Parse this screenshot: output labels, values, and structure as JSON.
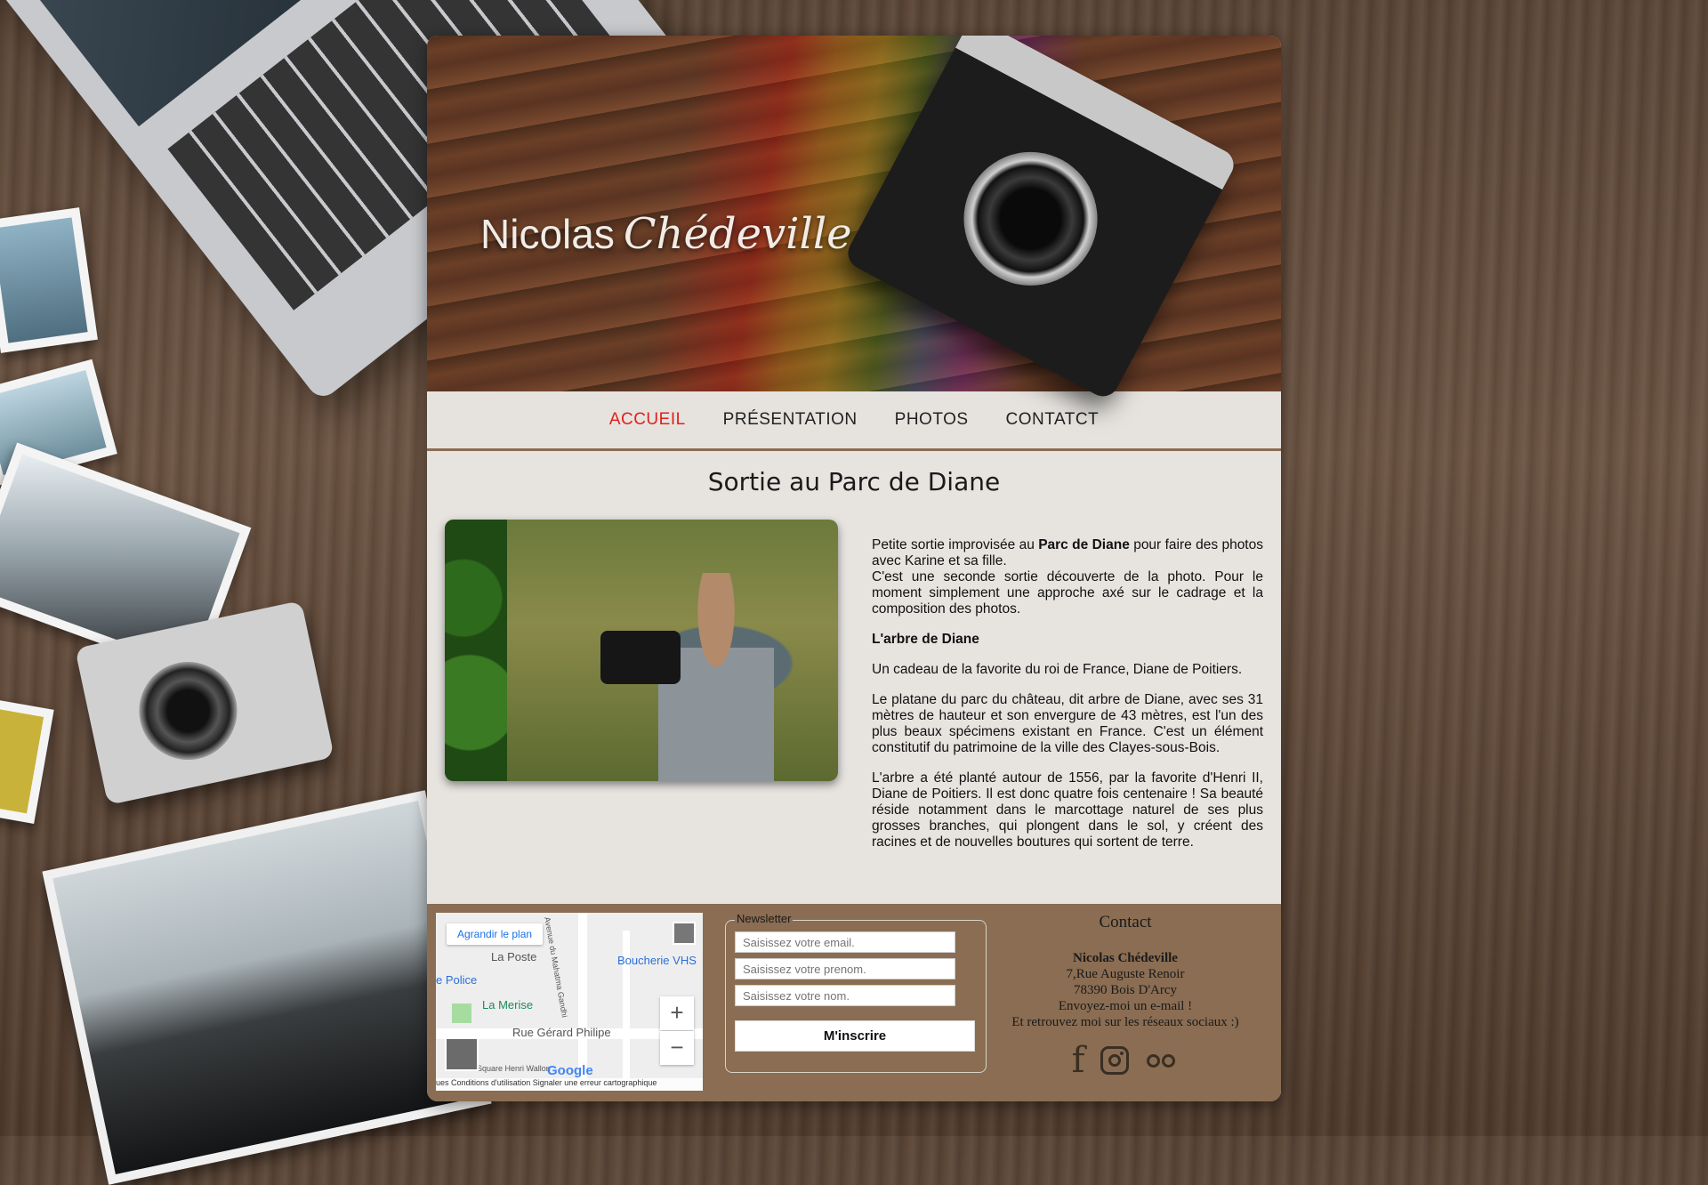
{
  "site": {
    "logo_first": "Nicolas",
    "logo_last": "Chédeville"
  },
  "nav": {
    "items": [
      {
        "label": "ACCUEIL",
        "active": true
      },
      {
        "label": "PRÉSENTATION",
        "active": false
      },
      {
        "label": "PHOTOS",
        "active": false
      },
      {
        "label": "CONTATCT",
        "active": false
      }
    ]
  },
  "article": {
    "title": "Sortie au Parc de Diane",
    "p1_pre": "Petite sortie improvisée au ",
    "p1_bold": "Parc de Diane",
    "p1_post": " pour faire des photos avec Karine et sa fille.",
    "p1_line2": "C'est une seconde sortie découverte de la photo. Pour le moment simplement une approche axé sur le cadrage et la composition des photos.",
    "subtitle": "L'arbre de Diane",
    "p2": "Un cadeau de la favorite du roi de France, Diane de Poitiers.",
    "p3": "Le platane du parc du château, dit arbre de Diane, avec ses 31 mètres de hauteur et son envergure de 43 mètres, est l'un des plus beaux spécimens existant en France. C'est un élément constitutif du patrimoine de la ville des Clayes-sous-Bois.",
    "p4": "L'arbre a été planté autour de 1556, par la favorite d'Henri II, Diane de Poitiers. Il est donc quatre fois centenaire ! Sa beauté réside notamment dans le marcottage naturel de ses plus grosses branches, qui plongent dans le sol, y créent des racines et de nouvelles boutures qui sortent de terre."
  },
  "map": {
    "enlarge": "Agrandir le plan",
    "labels": {
      "poste": "La Poste",
      "boucherie": "Boucherie VHS",
      "police": "e Police",
      "merise": "La Merise",
      "rue": "Rue Gérard Philipe",
      "avenue": "Avenue du Mahatma Gandhi",
      "square": "Square Henri Wallon",
      "google": "Google"
    },
    "attribution": "ues   Conditions d'utilisation   Signaler une erreur cartographique"
  },
  "newsletter": {
    "legend": "Newsletter",
    "email_placeholder": "Saisissez votre email.",
    "prenom_placeholder": "Saisissez votre prenom.",
    "nom_placeholder": "Saisissez votre nom.",
    "submit": "M'inscrire"
  },
  "contact": {
    "title": "Contact",
    "name": "Nicolas Chédeville",
    "address1": "7,Rue Auguste Renoir",
    "address2": "78390 Bois D'Arcy",
    "email_line": "Envoyez-moi un e-mail !",
    "social_line": "Et retrouvez moi sur les réseaux sociaux :)",
    "socials": [
      "facebook-icon",
      "instagram-icon",
      "flickr-icon"
    ]
  },
  "colors": {
    "accent": "#e0201a",
    "footer": "#8a6d52",
    "nav_border": "#8a6d54"
  }
}
